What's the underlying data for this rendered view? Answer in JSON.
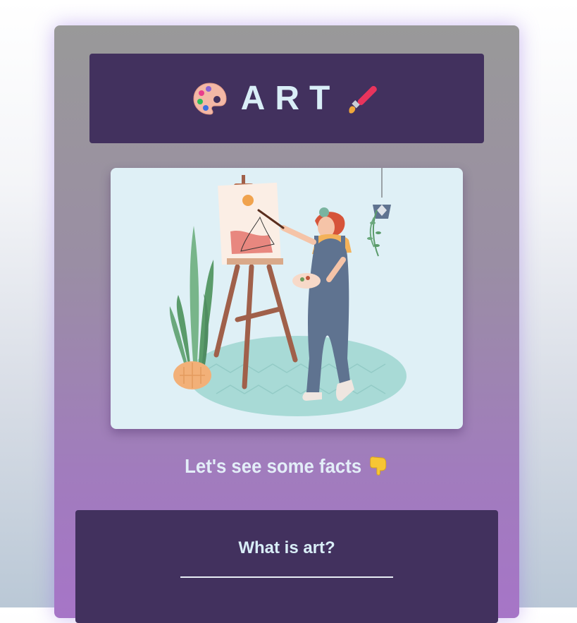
{
  "header": {
    "title": "ART",
    "left_icon": "artist-palette-icon",
    "right_icon": "paintbrush-icon"
  },
  "illustration": {
    "subject": "woman-painting-at-easel-illustration"
  },
  "facts_line": {
    "text": "Let's see some facts",
    "icon": "pointing-down-hand-icon"
  },
  "section": {
    "title": "What is art?"
  },
  "colors": {
    "card_top": "#999999",
    "card_bottom": "#a675c7",
    "panel": "#42315e",
    "title_text": "#d9eef7",
    "illustration_bg": "#dff0f6"
  }
}
